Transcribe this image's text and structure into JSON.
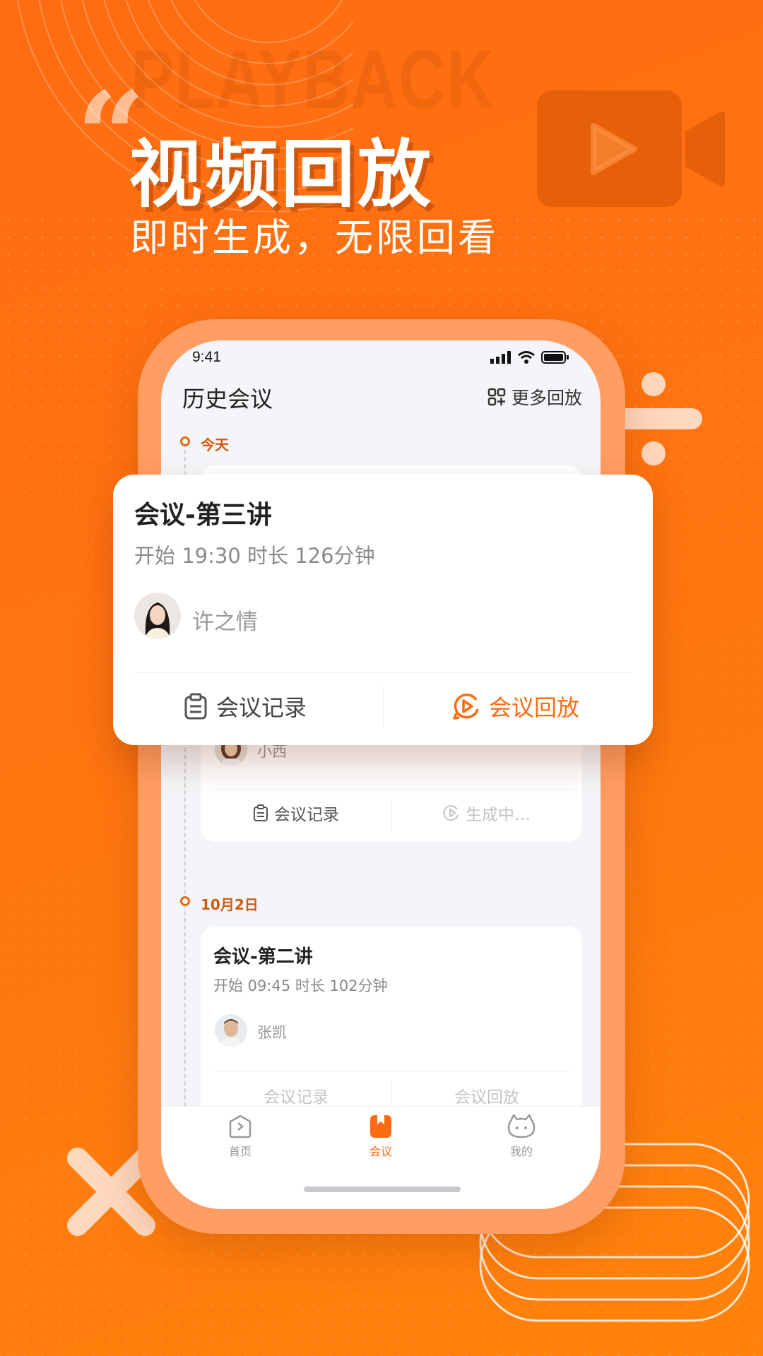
{
  "hero": {
    "watermark": "PLAYBACK",
    "quote_mark": "“",
    "headline": "视频回放",
    "subheadline": "即时生成，无限回看"
  },
  "status_bar": {
    "time": "9:41"
  },
  "app": {
    "title": "历史会议",
    "more_playback": "更多回放"
  },
  "timeline": [
    {
      "date_label": "今天"
    },
    {
      "date_label": "10月2日"
    }
  ],
  "featured_card": {
    "title": "会议-第三讲",
    "meta": "开始 19:30    时长 126分钟",
    "host": "许之情",
    "record_label": "会议记录",
    "playback_label": "会议回放"
  },
  "today_card_2": {
    "host": "小西",
    "record_label": "会议记录",
    "status_label": "生成中…"
  },
  "oct2_card": {
    "title": "会议-第二讲",
    "meta": "开始 09:45    时长 102分钟",
    "host": "张凯",
    "record_label": "会议记录",
    "playback_label": "会议回放"
  },
  "tabbar": [
    {
      "label": "首页",
      "icon": "home-icon",
      "active": false
    },
    {
      "label": "会议",
      "icon": "bookmark-icon",
      "active": true
    },
    {
      "label": "我的",
      "icon": "profile-icon",
      "active": false
    }
  ],
  "colors": {
    "accent": "#ff6b12",
    "phone_frame": "#ff9d62",
    "timeline_accent": "#d05a10"
  }
}
